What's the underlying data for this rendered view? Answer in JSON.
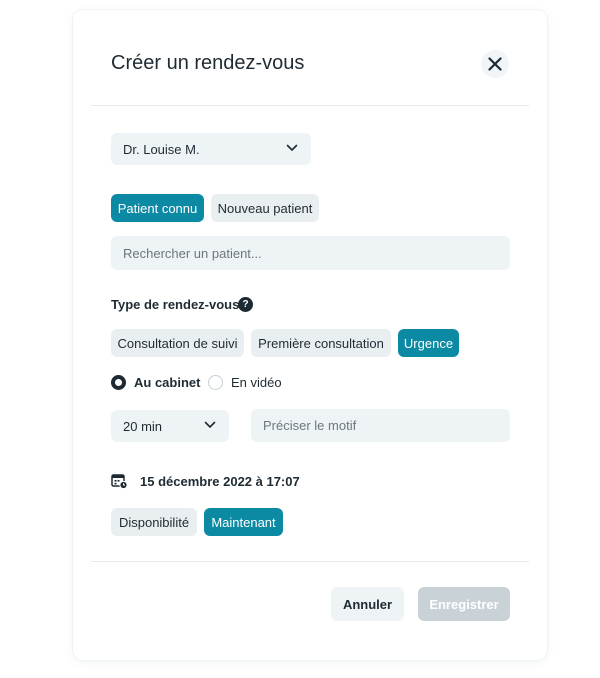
{
  "modal": {
    "title": "Créer un rendez-vous",
    "close_icon": "close-icon"
  },
  "practitioner": {
    "selected": "Dr. Louise M."
  },
  "patient_mode": {
    "options": [
      "Patient connu",
      "Nouveau patient"
    ],
    "active": "Patient connu"
  },
  "patient_search": {
    "placeholder": "Rechercher un patient..."
  },
  "appointment_type": {
    "label": "Type de rendez-vous",
    "help_icon": "question-circle-icon",
    "options": [
      "Consultation de suivi",
      "Première consultation",
      "Urgence"
    ],
    "active": "Urgence"
  },
  "location": {
    "options": [
      "Au cabinet",
      "En vidéo"
    ],
    "selected": "Au cabinet"
  },
  "duration": {
    "selected": "20 min"
  },
  "motif": {
    "placeholder": "Préciser le motif"
  },
  "datetime": {
    "icon": "calendar-clock-icon",
    "value": "15 décembre 2022 à 17:07"
  },
  "timing": {
    "options": [
      "Disponibilité",
      "Maintenant"
    ],
    "active": "Maintenant"
  },
  "footer": {
    "cancel_label": "Annuler",
    "save_label": "Enregistrer"
  },
  "colors": {
    "accent": "#0c8aa4",
    "chip_bg": "#e9eef0",
    "disabled_button": "#c9d3d7"
  }
}
